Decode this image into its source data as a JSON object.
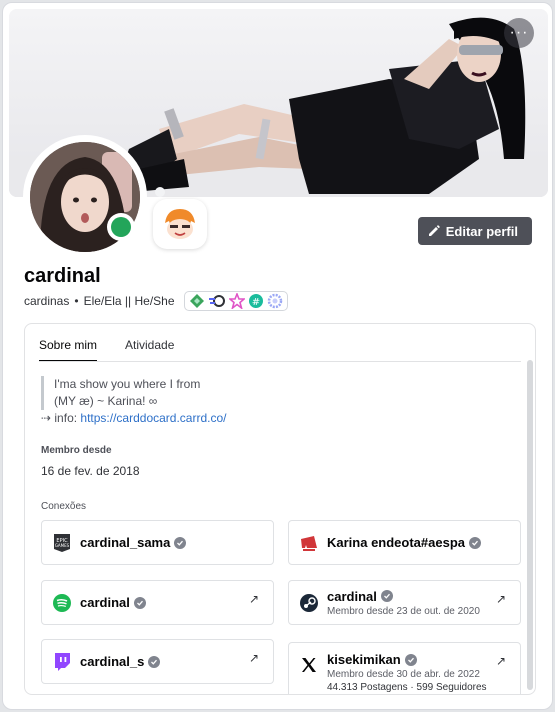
{
  "profile": {
    "display_name": "cardinal",
    "username": "cardinas",
    "separator": "•",
    "pronouns": "Ele/Ela || He/She",
    "status": "online",
    "status_color": "#23a55a"
  },
  "actions": {
    "edit_profile": "Editar perfil",
    "more": "···"
  },
  "tabs": [
    {
      "label": "Sobre mim",
      "active": true
    },
    {
      "label": "Atividade",
      "active": false
    }
  ],
  "bio": {
    "line1": "I'ma show you where I from",
    "line2": "(MY æ) ~ Karina! ∞",
    "info_prefix": "⇢ info: ",
    "link": "https://carddocard.carrd.co/"
  },
  "member_since": {
    "label": "Membro desde",
    "date": "16 de fev. de 2018"
  },
  "connections": {
    "label": "Conexões",
    "items": [
      {
        "service": "epic-games",
        "name": "cardinal_sama",
        "meta": "",
        "meta2": ""
      },
      {
        "service": "riot-games",
        "name": "Karina endeota#aespa",
        "meta": "",
        "meta2": ""
      },
      {
        "service": "spotify",
        "name": "cardinal",
        "meta": "",
        "meta2": ""
      },
      {
        "service": "steam",
        "name": "cardinal",
        "meta": "Membro desde 23 de out. de 2020",
        "meta2": ""
      },
      {
        "service": "twitch",
        "name": "cardinal_s",
        "meta": "",
        "meta2": ""
      },
      {
        "service": "x",
        "name": "kisekimikan",
        "meta": "Membro desde 30 de abr. de 2022",
        "meta2": "44.313 Postagens · 599 Seguidores"
      }
    ],
    "external_arrow": "↗"
  },
  "colors": {
    "accent_button": "#4e5058",
    "link": "#2e70c8",
    "spotify": "#1db954",
    "twitch": "#9146ff",
    "riot": "#d13639"
  }
}
